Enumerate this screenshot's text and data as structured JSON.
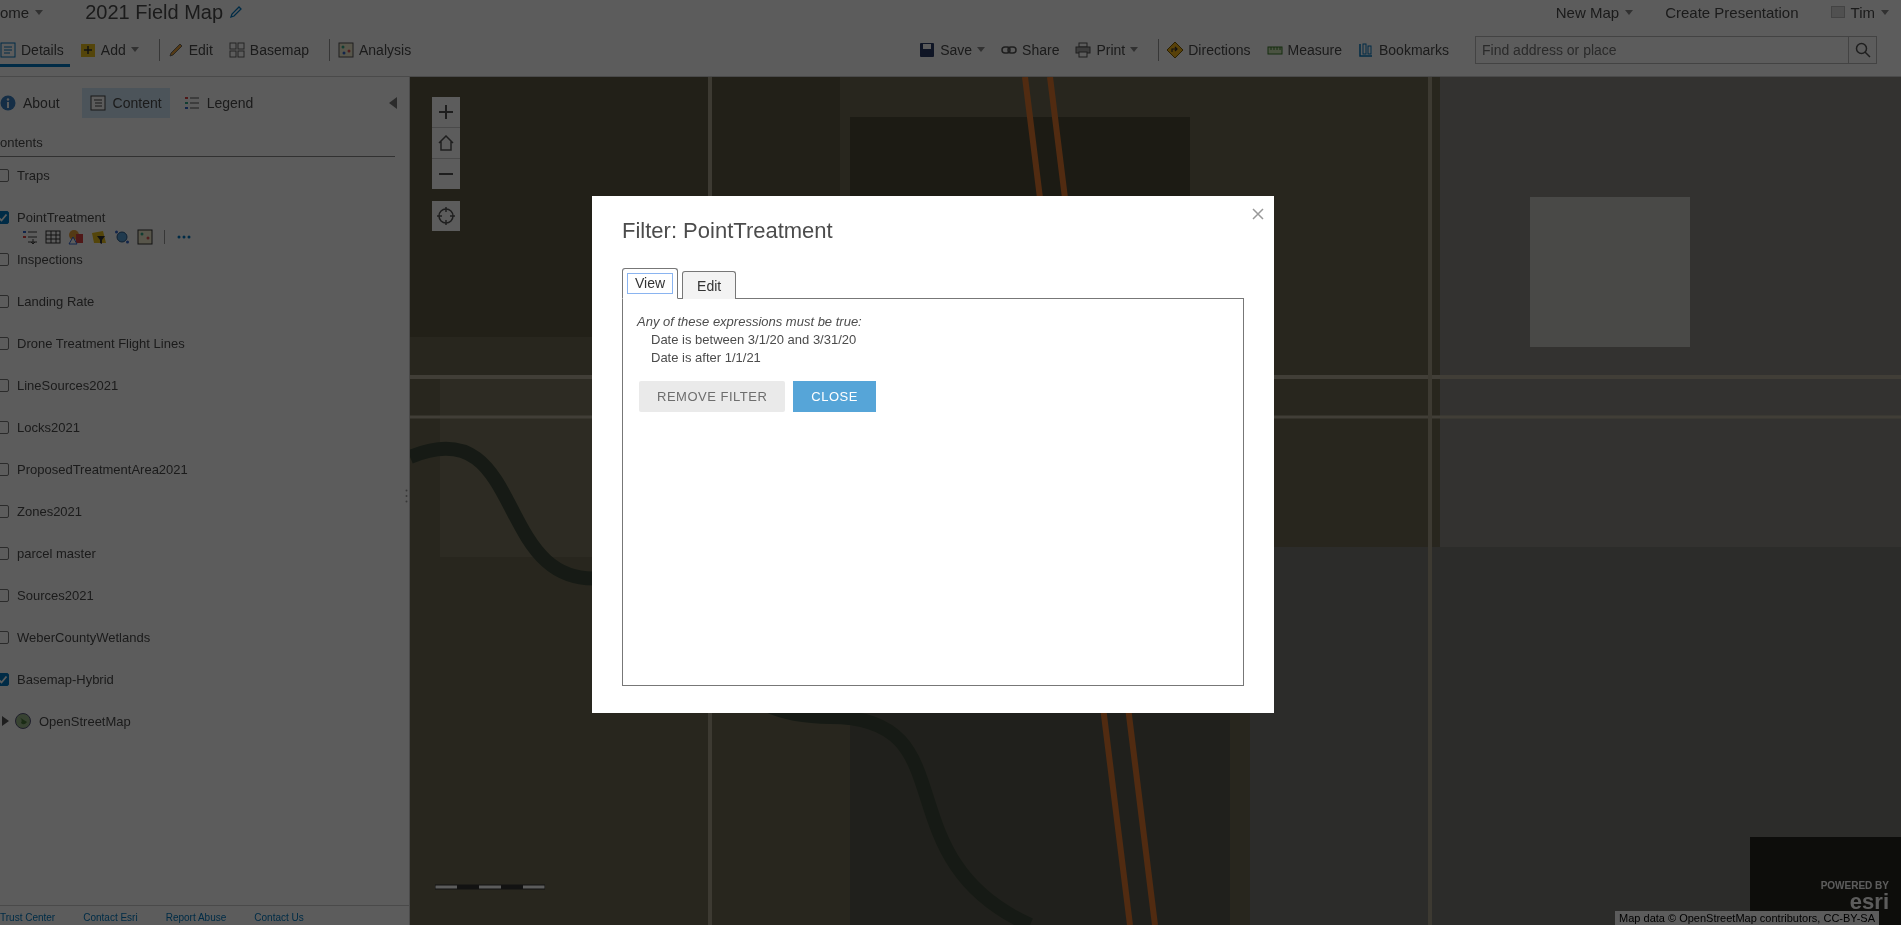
{
  "header": {
    "home_menu": {
      "label": "ome",
      "dropdown": true
    },
    "map_title": "2021 Field Map",
    "right_menu": [
      {
        "label": "New Map",
        "dropdown": true
      },
      {
        "label": "Create Presentation",
        "dropdown": false
      },
      {
        "label": "Tim",
        "dropdown": true
      }
    ]
  },
  "toolbar": {
    "left": [
      {
        "label": "Details",
        "selected": true,
        "dropdown": false
      },
      {
        "label": "Add",
        "selected": false,
        "dropdown": true
      },
      {
        "label": "Edit",
        "selected": false,
        "dropdown": false
      },
      {
        "label": "Basemap",
        "selected": false,
        "dropdown": false
      },
      {
        "label": "Analysis",
        "selected": false,
        "dropdown": false
      }
    ],
    "right": [
      {
        "label": "Save",
        "dropdown": true
      },
      {
        "label": "Share",
        "dropdown": false
      },
      {
        "label": "Print",
        "dropdown": true
      },
      {
        "label": "Directions",
        "dropdown": false
      },
      {
        "label": "Measure",
        "dropdown": false
      },
      {
        "label": "Bookmarks",
        "dropdown": false
      }
    ],
    "search": {
      "placeholder": "Find address or place"
    }
  },
  "sidebar": {
    "tabs": [
      {
        "label": "About",
        "selected": false
      },
      {
        "label": "Content",
        "selected": true
      },
      {
        "label": "Legend",
        "selected": false
      }
    ],
    "heading": "ontents",
    "layers": [
      {
        "name": "Traps",
        "kind": "layer",
        "checked": false
      },
      {
        "name": "PointTreatment",
        "kind": "layer",
        "checked": true,
        "tools": true
      },
      {
        "name": "Inspections",
        "kind": "layer",
        "checked": false
      },
      {
        "name": "Landing Rate",
        "kind": "layer",
        "checked": false
      },
      {
        "name": "Drone Treatment Flight Lines",
        "kind": "layer",
        "checked": false
      },
      {
        "name": "LineSources2021",
        "kind": "layer",
        "checked": false
      },
      {
        "name": "Locks2021",
        "kind": "layer",
        "checked": false
      },
      {
        "name": "ProposedTreatmentArea2021",
        "kind": "layer",
        "checked": false
      },
      {
        "name": "Zones2021",
        "kind": "layer",
        "checked": false
      },
      {
        "name": "parcel master",
        "kind": "layer",
        "checked": false
      },
      {
        "name": "Sources2021",
        "kind": "layer",
        "checked": false
      },
      {
        "name": "WeberCountyWetlands",
        "kind": "layer",
        "checked": false
      },
      {
        "name": "Basemap-Hybrid",
        "kind": "layer",
        "checked": true
      },
      {
        "name": "OpenStreetMap",
        "kind": "group",
        "expanded": false
      }
    ],
    "footer_links": [
      "Trust Center",
      "Contact Esri",
      "Report Abuse",
      "Contact Us"
    ]
  },
  "map": {
    "kind": "picture",
    "attribution": "Map data © OpenStreetMap contributors, CC-BY-SA",
    "powered_by": "POWERED BY",
    "logo": "esri"
  },
  "dialog": {
    "title": "Filter: PointTreatment",
    "tabs": [
      {
        "label": "View",
        "selected": true
      },
      {
        "label": "Edit",
        "selected": false
      }
    ],
    "intro": "Any of these expressions must be true:",
    "expressions": [
      "Date is between 3/1/20 and 3/31/20",
      "Date is after 1/1/21"
    ],
    "buttons": [
      {
        "label": "REMOVE FILTER",
        "kind": "secondary"
      },
      {
        "label": "CLOSE",
        "kind": "primary"
      }
    ]
  }
}
